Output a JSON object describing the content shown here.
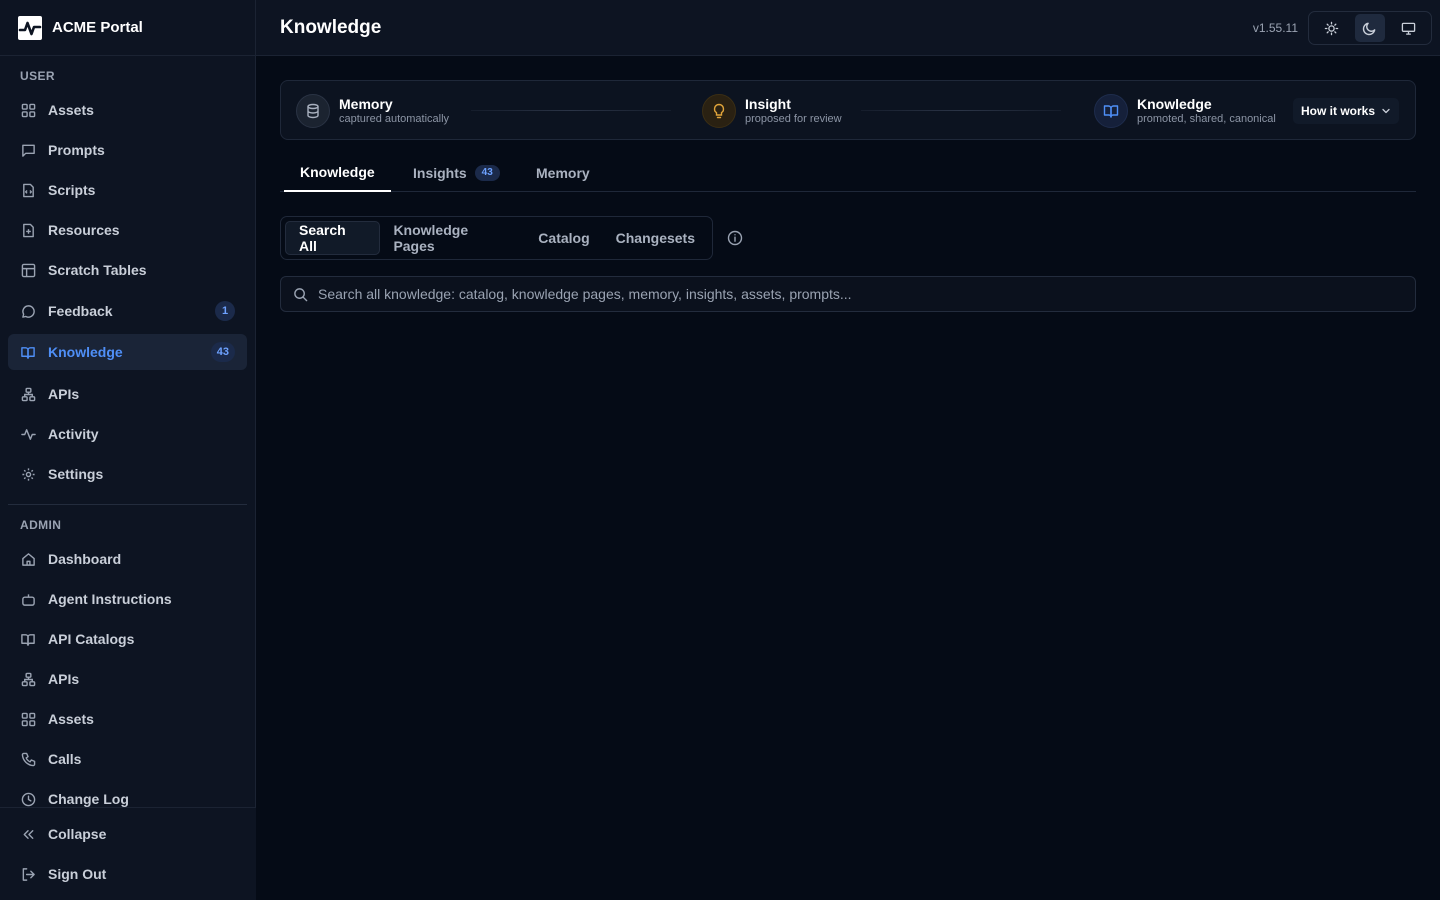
{
  "brand": {
    "name": "ACME Portal"
  },
  "sidebar": {
    "user_label": "USER",
    "user_items": [
      {
        "label": "Assets",
        "icon": "grid-icon"
      },
      {
        "label": "Prompts",
        "icon": "message-square-icon"
      },
      {
        "label": "Scripts",
        "icon": "file-code-icon"
      },
      {
        "label": "Resources",
        "icon": "file-box-icon"
      },
      {
        "label": "Scratch Tables",
        "icon": "table-icon"
      },
      {
        "label": "Feedback",
        "icon": "message-circle-icon",
        "badge": "1"
      },
      {
        "label": "Knowledge",
        "icon": "book-open-icon",
        "badge": "43",
        "active": true
      },
      {
        "label": "APIs",
        "icon": "network-icon"
      },
      {
        "label": "Activity",
        "icon": "activity-icon"
      },
      {
        "label": "Settings",
        "icon": "gear-icon"
      }
    ],
    "admin_label": "ADMIN",
    "admin_items": [
      {
        "label": "Dashboard",
        "icon": "home-icon"
      },
      {
        "label": "Agent Instructions",
        "icon": "bot-icon"
      },
      {
        "label": "API Catalogs",
        "icon": "book-open-icon"
      },
      {
        "label": "APIs",
        "icon": "network-icon"
      },
      {
        "label": "Assets",
        "icon": "grid-icon"
      },
      {
        "label": "Calls",
        "icon": "phone-icon"
      },
      {
        "label": "Change Log",
        "icon": "clock-icon"
      }
    ],
    "footer": {
      "collapse": "Collapse",
      "sign_out": "Sign Out"
    }
  },
  "header": {
    "title": "Knowledge",
    "version": "v1.55.11",
    "theme_modes": [
      "light",
      "dark",
      "system"
    ],
    "theme_selected": "dark"
  },
  "pipeline": {
    "stages": [
      {
        "title": "Memory",
        "subtitle": "captured automatically",
        "icon": "database-icon"
      },
      {
        "title": "Insight",
        "subtitle": "proposed for review",
        "icon": "lightbulb-icon"
      },
      {
        "title": "Knowledge",
        "subtitle": "promoted, shared, canonical",
        "icon": "book-open-icon"
      }
    ],
    "how_it_works": "How it works"
  },
  "tabs": [
    {
      "label": "Knowledge",
      "active": true
    },
    {
      "label": "Insights",
      "badge": "43"
    },
    {
      "label": "Memory"
    }
  ],
  "subtabs": [
    {
      "label": "Search All",
      "active": true
    },
    {
      "label": "Knowledge Pages"
    },
    {
      "label": "Catalog"
    },
    {
      "label": "Changesets"
    }
  ],
  "search": {
    "placeholder": "Search all knowledge: catalog, knowledge pages, memory, insights, assets, prompts...",
    "value": ""
  },
  "colors": {
    "accent": "#4f8ff7",
    "background": "#050b16",
    "sidebar": "#0d1422",
    "insight": "#e0a43a"
  }
}
